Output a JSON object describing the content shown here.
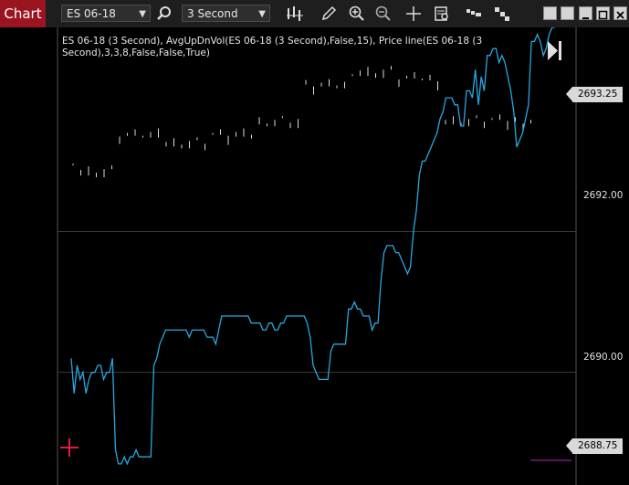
{
  "toolbar": {
    "tab_label": "Chart",
    "instrument": "ES 06-18",
    "interval": "3 Second",
    "icons": [
      "search-icon",
      "bar-type-icon",
      "pencil-icon",
      "zoom-in-icon",
      "zoom-out-icon",
      "crosshair-icon",
      "data-box-icon",
      "chart-trader-icon",
      "strategies-icon"
    ],
    "window_buttons": [
      "tile-icon",
      "tile-icon",
      "minimize-icon",
      "maximize-icon",
      "close-icon"
    ]
  },
  "indicator_label": "ES 06-18 (3 Second), AvgUpDnVol(ES 06-18 (3 Second),False,15), Price line(ES 06-18 (3 Second),3,3,8,False,False,True)",
  "price_axis": {
    "labels": [
      "2692.00",
      "2690.00"
    ],
    "badges": [
      "2693.25",
      "2688.75"
    ]
  },
  "colors": {
    "tab": "#9b1520",
    "line": "#27a8e0",
    "price_line": "#c020c0",
    "crosshair": "#e0203a",
    "gridline": "#3a3a3a"
  },
  "chart_data": {
    "type": "line",
    "title": "",
    "xlabel": "",
    "ylabel": "",
    "ylim": [
      2688.4,
      2694.9
    ],
    "y_grid": [
      2692.0,
      2690.0
    ],
    "series": [
      {
        "values": [
          2690.2,
          2689.7,
          2690.1,
          2689.9,
          2690.0,
          2689.7,
          2689.9,
          2690.0,
          2690.0,
          2690.1,
          2690.1,
          2689.9,
          2690.0,
          2690.0,
          2690.2,
          2688.9,
          2688.7,
          2688.7,
          2688.8,
          2688.7,
          2688.8,
          2688.8,
          2688.9,
          2688.8,
          2688.8,
          2688.8,
          2688.8,
          2688.8,
          2690.1,
          2690.2,
          2690.4,
          2690.5,
          2690.6,
          2690.6,
          2690.6,
          2690.6,
          2690.6,
          2690.6,
          2690.6,
          2690.6,
          2690.5,
          2690.6,
          2690.6,
          2690.6,
          2690.6,
          2690.6,
          2690.5,
          2690.5,
          2690.5,
          2690.4,
          2690.6,
          2690.8,
          2690.8,
          2690.8,
          2690.8,
          2690.8,
          2690.8,
          2690.8,
          2690.8,
          2690.8,
          2690.8,
          2690.7,
          2690.7,
          2690.7,
          2690.7,
          2690.6,
          2690.6,
          2690.7,
          2690.7,
          2690.6,
          2690.6,
          2690.7,
          2690.7,
          2690.8,
          2690.8,
          2690.8,
          2690.8,
          2690.8,
          2690.8,
          2690.8,
          2690.7,
          2690.5,
          2690.1,
          2690.0,
          2689.9,
          2689.9,
          2689.9,
          2689.9,
          2690.3,
          2690.4,
          2690.4,
          2690.4,
          2690.4,
          2690.4,
          2690.9,
          2690.9,
          2691.0,
          2690.9,
          2690.9,
          2690.8,
          2690.8,
          2690.8,
          2690.6,
          2690.7,
          2690.7,
          2691.3,
          2691.7,
          2691.8,
          2691.8,
          2691.8,
          2691.7,
          2691.7,
          2691.6,
          2691.5,
          2691.4,
          2691.5,
          2692.0,
          2692.3,
          2692.8,
          2693.0,
          2693.0,
          2693.1,
          2693.2,
          2693.3,
          2693.4,
          2693.6,
          2693.7,
          2693.9,
          2693.9,
          2693.9,
          2693.8,
          2693.8,
          2693.5,
          2693.5,
          2694.0,
          2694.0,
          2693.9,
          2694.3,
          2693.8,
          2694.2,
          2694.0,
          2694.5,
          2694.5,
          2694.6,
          2694.6,
          2694.4,
          2694.5,
          2694.4,
          2694.2,
          2694.0,
          2693.7,
          2693.2,
          2693.3,
          2693.4,
          2693.6,
          2693.8,
          2694.7,
          2694.7,
          2694.8,
          2694.7,
          2694.5,
          2694.6,
          2694.8,
          2694.9,
          2694.9
        ]
      }
    ],
    "price_line": 2688.75,
    "vbar_levels": [
      2692.9,
      2693.4,
      2693.3,
      2693.4,
      2693.6,
      2694.1,
      2694.3,
      2694.2,
      2693.6,
      2693.6
    ]
  }
}
